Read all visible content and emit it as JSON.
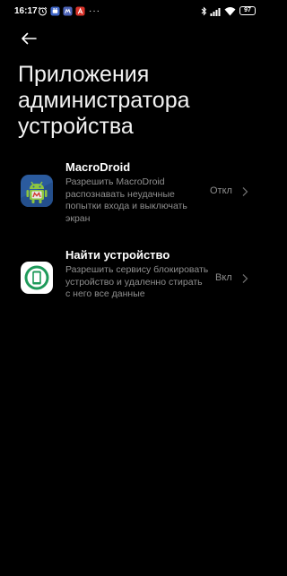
{
  "status_bar": {
    "time": "16:17",
    "battery": "97",
    "more": "···"
  },
  "header": {
    "title": "Приложения администратора устройства"
  },
  "apps": [
    {
      "name": "MacroDroid",
      "description": "Разрешить MacroDroid распознавать неудачные попытки входа и выключать экран",
      "status": "Откл",
      "icon": "macrodroid-robot-icon"
    },
    {
      "name": "Найти устройство",
      "description": "Разрешить сервису блокировать устройство и удаленно стирать с него все данные",
      "status": "Вкл",
      "icon": "find-device-icon"
    }
  ],
  "colors": {
    "background": "#000000",
    "primary_text": "#ffffff",
    "secondary_text": "#8f8f8f",
    "macrodroid_icon_bg": "#2b5b9e",
    "find_device_green": "#1e9a5a"
  }
}
